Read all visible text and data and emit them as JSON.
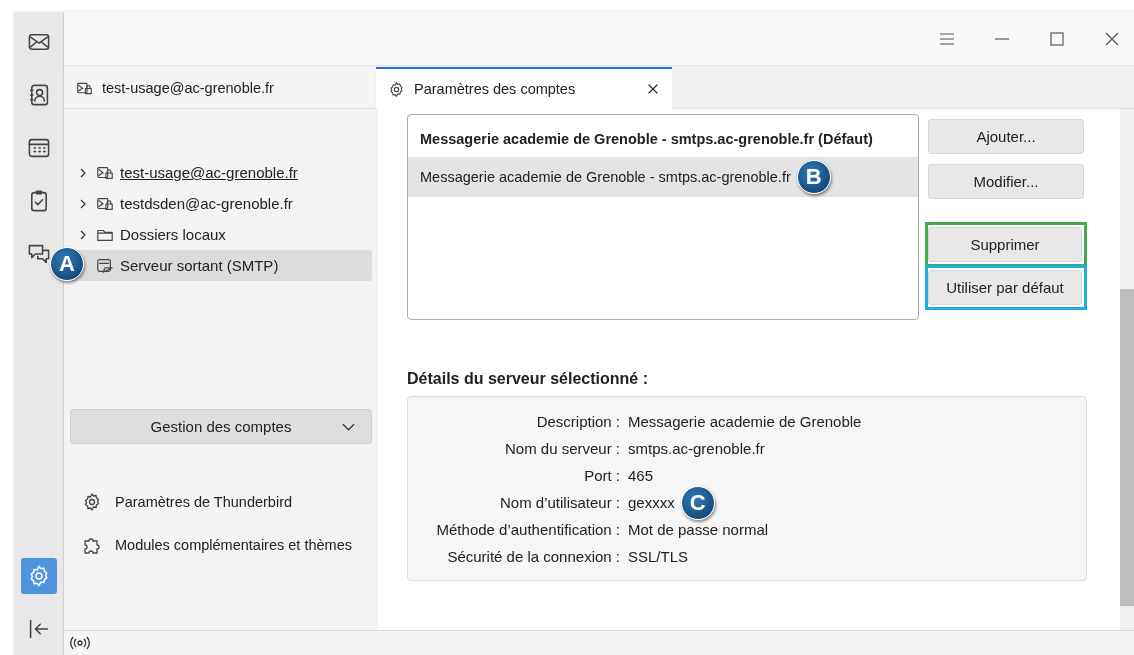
{
  "spaces": [
    {
      "kind": "mail",
      "selected": false
    },
    {
      "kind": "contacts",
      "selected": false
    },
    {
      "kind": "calendar",
      "selected": false
    },
    {
      "kind": "tasks",
      "selected": false
    },
    {
      "kind": "chat",
      "selected": false
    }
  ],
  "spaces_bottom": [
    {
      "kind": "settings",
      "selected": true
    },
    {
      "kind": "collapse",
      "selected": false
    }
  ],
  "tabs": [
    {
      "label": "test-usage@ac-grenoble.fr",
      "kind": "account",
      "selected": false,
      "closable": false
    },
    {
      "label": "Paramètres des comptes",
      "kind": "settings",
      "selected": true,
      "closable": true
    }
  ],
  "tree": [
    {
      "label": "test-usage@ac-grenoble.fr",
      "kind": "account",
      "expandable": true,
      "underlined": true,
      "selected": false
    },
    {
      "label": "testdsden@ac-grenoble.fr",
      "kind": "account",
      "expandable": true,
      "underlined": false,
      "selected": false
    },
    {
      "label": "Dossiers locaux",
      "kind": "folder",
      "expandable": true,
      "underlined": false,
      "selected": false
    },
    {
      "label": "Serveur sortant (SMTP)",
      "kind": "smtp",
      "expandable": false,
      "underlined": false,
      "selected": true,
      "badge": "A"
    }
  ],
  "account_actions": {
    "label": "Gestion des comptes"
  },
  "pane_links": [
    {
      "label": "Paramètres de Thunderbird",
      "kind": "settings"
    },
    {
      "label": "Modules complémentaires et thèmes",
      "kind": "addons"
    }
  ],
  "server_list": [
    {
      "label": "Messagerie academie de Grenoble - smtps.ac-grenoble.fr (Défaut)",
      "default": true,
      "selected": false
    },
    {
      "label": "Messagerie academie de Grenoble - smtps.ac-grenoble.fr",
      "default": false,
      "selected": true,
      "badge": "B"
    }
  ],
  "buttons": [
    {
      "label": "Ajouter..."
    },
    {
      "label": "Modifier..."
    },
    {
      "label": "Supprimer",
      "color": "#3fae49"
    },
    {
      "label": "Utiliser par défaut",
      "color": "#1eaee6"
    }
  ],
  "details": {
    "title": "Détails du serveur sélectionné :",
    "rows": [
      {
        "label": "Description :",
        "value": "Messagerie academie de Grenoble"
      },
      {
        "label": "Nom du serveur :",
        "value": "smtps.ac-grenoble.fr"
      },
      {
        "label": "Port :",
        "value": "465"
      },
      {
        "label": "Nom d’utilisateur :",
        "value": "gexxxx",
        "badge": "C"
      },
      {
        "label": "Méthode d’authentification :",
        "value": "Mot de passe normal"
      },
      {
        "label": "Sécurité de la connexion :",
        "value": "SSL/TLS"
      }
    ]
  }
}
